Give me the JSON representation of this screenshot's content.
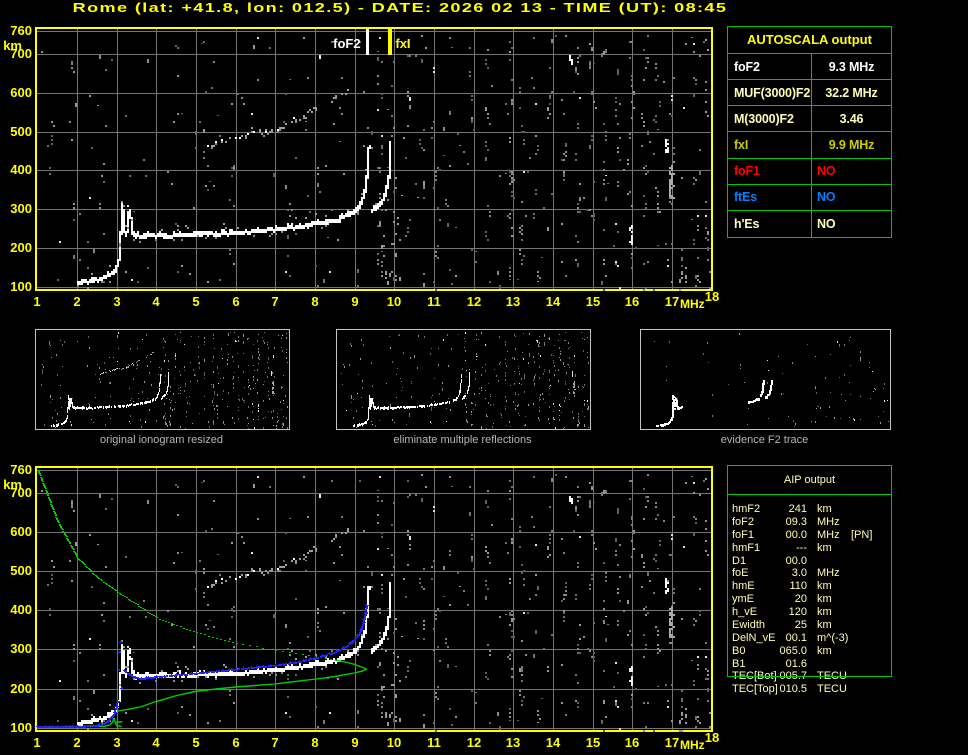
{
  "title": "Rome (lat: +41.8, lon: 012.5) - DATE: 2026 02 13 - TIME (UT): 08:45",
  "colors": {
    "background": "#000000",
    "accent_yellow": "#ffff00",
    "pale_yellow": "#ffffb4",
    "dim_yellow": "#cccc00",
    "table_green": "#00c800",
    "profile_green": "#00cc00",
    "fit_blue": "#2222ff",
    "status_red": "#ff0000",
    "status_blue": "#0080ff",
    "grid_gray": "#747474",
    "trace_white": "#ffffff",
    "caption_gray": "#b6b6b6"
  },
  "autoscala_table": {
    "header": "AUTOSCALA output",
    "rows": [
      {
        "label": "foF2",
        "value": "9.3 MHz",
        "color": "#ffffff",
        "value_align": "center"
      },
      {
        "label": "MUF(3000)F2",
        "value": "32.2 MHz",
        "color": "#ffffb4",
        "value_align": "center"
      },
      {
        "label": "M(3000)F2",
        "value": "3.46",
        "color": "#ffffb4",
        "value_align": "center"
      },
      {
        "label": "fxI",
        "value": "9.9 MHz",
        "color": "#cccc00",
        "value_align": "center"
      },
      {
        "label": "foF1",
        "value": "NO",
        "color": "#ff0000",
        "value_align": "left"
      },
      {
        "label": "ftEs",
        "value": "NO",
        "color": "#0080ff",
        "value_align": "left"
      },
      {
        "label": "h'Es",
        "value": "NO",
        "color": "#ffffb4",
        "value_align": "left"
      }
    ]
  },
  "aip_table": {
    "header": "AIP output",
    "rows": [
      {
        "param": "hmF2",
        "value": "241",
        "unit": "km",
        "note": ""
      },
      {
        "param": "foF2",
        "value": "09.3",
        "unit": "MHz",
        "note": ""
      },
      {
        "param": "foF1",
        "value": "00.0",
        "unit": "MHz",
        "note": "[PN]"
      },
      {
        "param": "hmF1",
        "value": "---",
        "unit": "km",
        "note": ""
      },
      {
        "param": "D1",
        "value": "00.0",
        "unit": "",
        "note": ""
      },
      {
        "param": "foE",
        "value": "3.0",
        "unit": "MHz",
        "note": ""
      },
      {
        "param": "hmE",
        "value": "110",
        "unit": "km",
        "note": ""
      },
      {
        "param": "ymE",
        "value": "20",
        "unit": "km",
        "note": ""
      },
      {
        "param": "h_vE",
        "value": "120",
        "unit": "km",
        "note": ""
      },
      {
        "param": "Ewidth",
        "value": "25",
        "unit": "km",
        "note": ""
      },
      {
        "param": "DelN_vE",
        "value": "00.1",
        "unit": "m^(-3)",
        "note": ""
      },
      {
        "param": "B0",
        "value": "065.0",
        "unit": "km",
        "note": ""
      },
      {
        "param": "B1",
        "value": "01.6",
        "unit": "",
        "note": ""
      },
      {
        "param": "TEC[Bot]",
        "value": "005.7",
        "unit": "TECU",
        "note": ""
      },
      {
        "param": "TEC[Top]",
        "value": "010.5",
        "unit": "TECU",
        "note": ""
      }
    ]
  },
  "thumbnails": [
    {
      "caption": "original ionogram resized",
      "show_second_reflection": true,
      "trace_filter": "all",
      "noise_fraction": 0.6
    },
    {
      "caption": "eliminate multiple reflections",
      "show_second_reflection": false,
      "trace_filter": "all",
      "noise_fraction": 0.55
    },
    {
      "caption": "evidence F2 trace",
      "show_second_reflection": false,
      "trace_filter": "evidence",
      "noise_fraction": 0.12
    }
  ],
  "chart_data": [
    {
      "name": "recorded_ionogram",
      "type": "scatter",
      "xlabel": "MHz",
      "ylabel": "km",
      "xlim": [
        0.95,
        18.05
      ],
      "ylim": [
        88,
        760
      ],
      "xticks": [
        1,
        2,
        3,
        4,
        5,
        6,
        7,
        8,
        9,
        10,
        11,
        12,
        13,
        14,
        15,
        16,
        17,
        18
      ],
      "yticks": [
        760,
        700,
        600,
        500,
        400,
        300,
        200,
        100
      ],
      "grid": true,
      "markers": [
        {
          "label": "foF2",
          "freq_mhz": 9.3,
          "color": "#ffffff",
          "side": "left"
        },
        {
          "label": "fxI",
          "freq_mhz": 9.9,
          "color": "#ffff00",
          "side": "right"
        }
      ],
      "series": [
        {
          "name": "o-trace-tail",
          "color": "#ffffff",
          "points": [
            [
              1.98,
              115
            ],
            [
              2.2,
              118
            ],
            [
              2.5,
              124
            ],
            [
              2.75,
              132
            ],
            [
              2.9,
              142
            ],
            [
              3.0,
              158
            ],
            [
              3.05,
              180
            ],
            [
              3.07,
              215
            ],
            [
              3.09,
              260
            ],
            [
              3.1,
              305
            ],
            [
              3.12,
              318
            ]
          ]
        },
        {
          "name": "o-trace-cusp1",
          "color": "#ffffff",
          "points": [
            [
              3.15,
              300
            ],
            [
              3.18,
              250
            ],
            [
              3.2,
              235
            ]
          ]
        },
        {
          "name": "o-trace-cusp2",
          "color": "#ffffff",
          "points": [
            [
              3.25,
              250
            ],
            [
              3.28,
              290
            ],
            [
              3.3,
              305
            ]
          ]
        },
        {
          "name": "o-trace-cusp3",
          "color": "#ffffff",
          "points": [
            [
              3.33,
              285
            ],
            [
              3.38,
              245
            ],
            [
              3.45,
              236
            ]
          ]
        },
        {
          "name": "o-trace-main",
          "color": "#ffffff",
          "points": [
            [
              3.45,
              236
            ],
            [
              3.5,
              237
            ],
            [
              4,
              237
            ],
            [
              4.5,
              238
            ],
            [
              5,
              241
            ],
            [
              5.5,
              242
            ],
            [
              6,
              244
            ],
            [
              6.5,
              248
            ],
            [
              7,
              252
            ],
            [
              7.5,
              258
            ],
            [
              8,
              266
            ],
            [
              8.5,
              275
            ],
            [
              8.8,
              288
            ],
            [
              9.0,
              300
            ],
            [
              9.1,
              315
            ],
            [
              9.18,
              332
            ],
            [
              9.24,
              352
            ],
            [
              9.28,
              380
            ],
            [
              9.31,
              415
            ],
            [
              9.33,
              450
            ],
            [
              9.34,
              466
            ]
          ]
        },
        {
          "name": "x-trace",
          "color": "#ffffff",
          "points": [
            [
              9.4,
              298
            ],
            [
              9.5,
              306
            ],
            [
              9.6,
              316
            ],
            [
              9.68,
              328
            ],
            [
              9.75,
              343
            ],
            [
              9.8,
              362
            ],
            [
              9.84,
              388
            ],
            [
              9.865,
              420
            ],
            [
              9.875,
              448
            ],
            [
              9.88,
              478
            ]
          ]
        },
        {
          "name": "second-reflection",
          "color": "#cccccc",
          "points": [
            [
              5.3,
              470
            ],
            [
              5.7,
              478
            ],
            [
              6.1,
              487
            ],
            [
              6.5,
              497
            ],
            [
              6.9,
              509
            ],
            [
              7.2,
              519
            ],
            [
              7.5,
              531
            ],
            [
              7.7,
              541
            ],
            [
              7.9,
              553
            ],
            [
              8.05,
              563
            ]
          ]
        },
        {
          "name": "second-reflection-faint",
          "color": "#999999",
          "points": [
            [
              8.2,
              572
            ],
            [
              8.5,
              588
            ],
            [
              8.8,
              603
            ],
            [
              9.0,
              615
            ]
          ]
        }
      ],
      "noise": {
        "seed": 77,
        "uniform_count": 210,
        "strip_freqs": [
          1.35,
          1.85,
          2.6,
          3.3,
          4.45,
          5.2,
          5.9,
          6.45,
          7.3,
          8.05,
          8.6,
          9.6,
          9.95,
          10.3,
          10.7,
          11.0,
          11.35,
          11.9,
          12.3,
          12.9,
          13.2,
          13.55,
          13.9,
          14.25,
          14.6,
          14.95,
          15.3,
          15.6,
          15.95,
          16.3,
          16.6,
          16.95,
          17.3,
          17.6,
          17.85
        ],
        "strip_count_left": 5,
        "strip_count_right": 11,
        "clusters": [
          {
            "f0": 16.9,
            "f1": 17.02,
            "h0": 325,
            "h1": 415,
            "n": 26,
            "color": "#aaaaaa"
          },
          {
            "f0": 16.82,
            "f1": 16.88,
            "h0": 450,
            "h1": 492,
            "n": 9,
            "color": "#ffffff"
          },
          {
            "f0": 15.92,
            "f1": 15.99,
            "h0": 215,
            "h1": 262,
            "n": 8,
            "color": "#eeeeee"
          },
          {
            "f0": 17.15,
            "f1": 17.35,
            "h0": 78,
            "h1": 152,
            "n": 13,
            "color": "#999999"
          },
          {
            "f0": 14.38,
            "f1": 14.44,
            "h0": 678,
            "h1": 702,
            "n": 5,
            "color": "#ffffff"
          },
          {
            "f0": 9.55,
            "f1": 10.1,
            "h0": 95,
            "h1": 300,
            "n": 20,
            "color": "#999999"
          }
        ]
      }
    },
    {
      "name": "autoscala_fit_and_profile",
      "type": "scatter",
      "xlabel": "MHz",
      "ylabel": "km",
      "xlim": [
        0.95,
        18.05
      ],
      "ylim": [
        88,
        760
      ],
      "xticks": [
        1,
        2,
        3,
        4,
        5,
        6,
        7,
        8,
        9,
        10,
        11,
        12,
        13,
        14,
        15,
        16,
        17,
        18
      ],
      "yticks": [
        760,
        700,
        600,
        500,
        400,
        300,
        200,
        100
      ],
      "grid": true,
      "series": [
        {
          "name": "electron-density-profile-topside",
          "color": "#00cc00",
          "style": "dots_per_height",
          "points": [
            [
              1.0,
              760
            ],
            [
              1.5,
              628
            ],
            [
              2.0,
              535
            ],
            [
              2.5,
              485
            ],
            [
              3.0,
              448
            ],
            [
              3.5,
              415
            ],
            [
              4.0,
              382
            ],
            [
              4.5,
              362
            ],
            [
              5.0,
              344
            ],
            [
              5.5,
              330
            ],
            [
              6.0,
              317
            ],
            [
              6.5,
              308
            ],
            [
              7.0,
              299
            ],
            [
              7.5,
              291
            ],
            [
              8.0,
              283
            ],
            [
              8.5,
              273
            ]
          ]
        },
        {
          "name": "electron-density-profile-nose",
          "color": "#00cc00",
          "style": "line",
          "points": [
            [
              8.5,
              273
            ],
            [
              8.8,
              267
            ],
            [
              9.0,
              262
            ],
            [
              9.1,
              258
            ],
            [
              9.2,
              254
            ],
            [
              9.3,
              250
            ]
          ]
        },
        {
          "name": "electron-density-profile-bottomside",
          "color": "#00cc00",
          "style": "line",
          "points": [
            [
              9.3,
              250
            ],
            [
              9.2,
              245
            ],
            [
              9.0,
              240
            ],
            [
              8.5,
              231
            ],
            [
              8.0,
              224
            ],
            [
              7.5,
              218
            ],
            [
              7.0,
              212
            ],
            [
              6.5,
              208
            ],
            [
              6.0,
              204
            ],
            [
              5.5,
              199
            ],
            [
              5.0,
              193
            ],
            [
              4.5,
              182
            ],
            [
              4.0,
              167
            ],
            [
              3.6,
              153
            ],
            [
              3.3,
              147
            ],
            [
              3.05,
              143
            ],
            [
              3.02,
              142
            ]
          ]
        },
        {
          "name": "profile-e-region-flat",
          "color": "#00cc00",
          "style": "line",
          "points": [
            [
              1.0,
              102
            ],
            [
              2.0,
              103
            ],
            [
              2.7,
              103.5
            ],
            [
              2.83,
              107
            ],
            [
              2.9,
              115
            ],
            [
              2.93,
              125
            ]
          ]
        },
        {
          "name": "profile-e-region-peak",
          "color": "#00cc00",
          "style": "line",
          "points": [
            [
              2.93,
              125
            ],
            [
              2.97,
              111
            ],
            [
              3.0,
              105
            ],
            [
              3.12,
              103
            ]
          ]
        },
        {
          "name": "profile-e-valley-stub",
          "color": "#00cc00",
          "style": "line",
          "points": [
            [
              2.97,
              114
            ],
            [
              3.14,
              115
            ]
          ]
        },
        {
          "name": "fitted-trace-low",
          "color": "#2222ff",
          "style": "bluedots",
          "points": [
            [
              1.0,
              104
            ],
            [
              1.5,
              104
            ],
            [
              2.0,
              105
            ],
            [
              2.4,
              106
            ],
            [
              2.6,
              109
            ],
            [
              2.75,
              117
            ],
            [
              2.85,
              127
            ],
            [
              2.92,
              140
            ],
            [
              2.97,
              155
            ],
            [
              3.0,
              168
            ]
          ]
        },
        {
          "name": "fitted-trace-main",
          "color": "#2222ff",
          "style": "bluedots",
          "points": [
            [
              3.18,
              247
            ],
            [
              3.3,
              237
            ],
            [
              3.45,
              230
            ],
            [
              3.6,
              227
            ],
            [
              3.8,
              229
            ],
            [
              4.0,
              231
            ],
            [
              4.5,
              236
            ],
            [
              5.0,
              241
            ],
            [
              5.5,
              246
            ],
            [
              6.0,
              251
            ],
            [
              6.5,
              256
            ],
            [
              7.0,
              261
            ],
            [
              7.5,
              269
            ],
            [
              8.0,
              280
            ],
            [
              8.4,
              292
            ],
            [
              8.7,
              306
            ],
            [
              8.9,
              319
            ],
            [
              9.05,
              336
            ],
            [
              9.15,
              355
            ],
            [
              9.22,
              377
            ],
            [
              9.26,
              397
            ],
            [
              9.29,
              413
            ]
          ]
        },
        {
          "name": "fitted-trace-singles",
          "color": "#2222ff",
          "style": "bluesingles",
          "points": [
            [
              3.03,
              250
            ],
            [
              3.05,
              296
            ],
            [
              3.08,
              322
            ],
            [
              3.1,
              203
            ]
          ]
        }
      ]
    }
  ]
}
